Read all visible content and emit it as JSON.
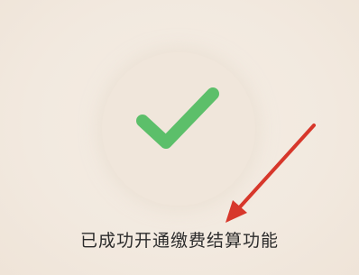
{
  "status": {
    "message": "已成功开通缴费结算功能",
    "icon": "checkmark-icon",
    "check_color": "#5cbf6a"
  },
  "annotation": {
    "icon": "arrow-icon",
    "color": "#d7372b"
  }
}
